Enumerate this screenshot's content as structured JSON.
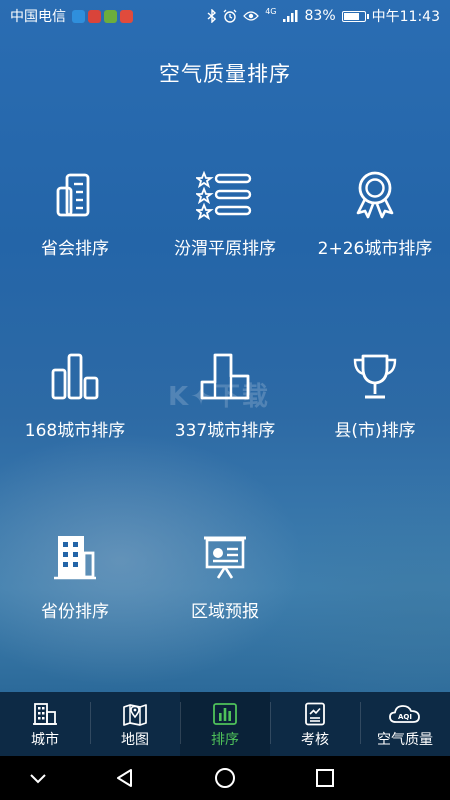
{
  "status_bar": {
    "carrier": "中国电信",
    "network": "4G",
    "battery": "83%",
    "battery_level": 0.83,
    "time": "中午11:43"
  },
  "header": {
    "title": "空气质量排序"
  },
  "grid": {
    "items": [
      {
        "label": "省会排序",
        "icon": "building-chart-icon"
      },
      {
        "label": "汾渭平原排序",
        "icon": "star-list-icon"
      },
      {
        "label": "2+26城市排序",
        "icon": "award-ribbon-icon"
      },
      {
        "label": "168城市排序",
        "icon": "bar-chart-icon"
      },
      {
        "label": "337城市排序",
        "icon": "stairs-shape-icon"
      },
      {
        "label": "县(市)排序",
        "icon": "trophy-icon"
      },
      {
        "label": "省份排序",
        "icon": "office-building-icon"
      },
      {
        "label": "区域预报",
        "icon": "presentation-board-icon"
      }
    ]
  },
  "tab_bar": {
    "tabs": [
      {
        "label": "城市",
        "icon": "city-building-icon",
        "active": false
      },
      {
        "label": "地图",
        "icon": "map-pin-icon",
        "active": false
      },
      {
        "label": "排序",
        "icon": "bar-chart-icon",
        "active": true
      },
      {
        "label": "考核",
        "icon": "report-icon",
        "active": false
      },
      {
        "label": "空气质量",
        "icon": "aqi-cloud-icon",
        "active": false
      }
    ]
  },
  "colors": {
    "background": "#2465a8",
    "tab_bar": "#0d2a45",
    "active_tab": "#4fc25a",
    "text": "#ffffff"
  }
}
